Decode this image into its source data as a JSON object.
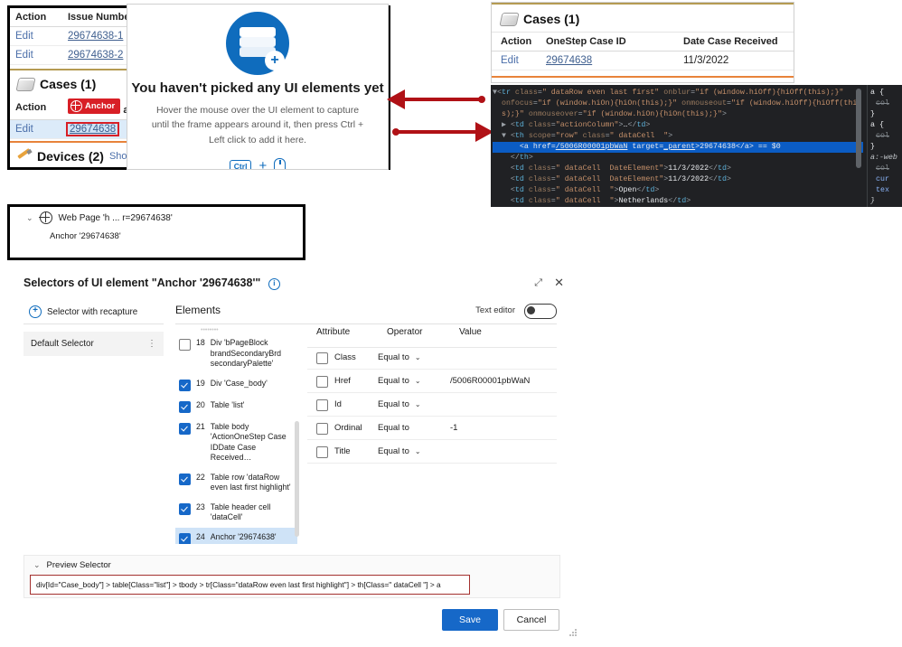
{
  "sf_left": {
    "issues_table": {
      "headers": [
        "Action",
        "Issue Number"
      ],
      "rows": [
        {
          "action": "Edit",
          "issue": "29674638-1"
        },
        {
          "action": "Edit",
          "issue": "29674638-2"
        }
      ]
    },
    "cases_section": {
      "title": "Cases (1)",
      "headers": {
        "action": "Action",
        "anchor_badge": "Anchor",
        "case_id": "ase ID"
      },
      "row": {
        "action": "Edit",
        "case_id": "29674638"
      }
    },
    "devices_section": {
      "title": "Devices (2)",
      "link": "Show"
    }
  },
  "picker": {
    "title": "You haven't picked any UI elements yet",
    "subtitle": "Hover the mouse over the UI element to capture until the frame appears around it, then press Ctrl + Left click to add it here.",
    "key_ctrl": "Ctrl",
    "key_plus": "+"
  },
  "sf_right": {
    "title": "Cases (1)",
    "headers": [
      "Action",
      "OneStep Case ID",
      "Date Case Received"
    ],
    "row": {
      "action": "Edit",
      "case_id": "29674638",
      "date_received": "11/3/2022"
    }
  },
  "devtools": {
    "dom_lines": [
      "▼<tr class=\" dataRow even last first\" onblur=\"if (window.hiOff){hiOff(this);}\"",
      "  onfocus=\"if (window.hiOn){hiOn(this);}\" onmouseout=\"if (window.hiOff){hiOff(thi",
      "  s);}\" onmouseover=\"if (window.hiOn){hiOn(this);}\">",
      "  ▶ <td class=\"actionColumn\">…</td>",
      "  ▼ <th scope=\"row\" class=\" dataCell  \">",
      "      <a href=\"/5006R00001pbWaN\" target=\"_parent\">29674638</a> == $0",
      "    </th>",
      "    <td class=\" dataCell  DateElement\">11/3/2022</td>",
      "    <td class=\" dataCell  DateElement\">11/3/2022</td>",
      "    <td class=\" dataCell  \">Open</td>",
      "    <td class=\" dataCell  \">Netherlands</td>"
    ],
    "selected_line": {
      "href": "/5006R00001pbWaN",
      "target": "_parent",
      "text": "29674638",
      "marker": "== $0"
    },
    "css_pane": [
      "a {",
      "col",
      "}",
      "a {",
      "col",
      "}",
      "a:-web",
      "col",
      "cur",
      "tex",
      "}"
    ]
  },
  "tree": {
    "root": "Web Page 'h ... r=29674638'",
    "child": "Anchor '29674638'"
  },
  "dialog": {
    "title": "Selectors of UI element \"Anchor '29674638'\"",
    "info_icon": "i",
    "expand_icon": "⤢",
    "close_icon": "✕",
    "left_pane": {
      "recapture_label": "Selector with recapture",
      "default_selector": "Default Selector"
    },
    "elements_label": "Elements",
    "text_editor_label": "Text editor",
    "text_editor_on": false,
    "elements": [
      {
        "num": "18",
        "label": "Div 'bPageBlock brandSecondaryBrd secondaryPalette'",
        "checked": false,
        "selected": false
      },
      {
        "num": "19",
        "label": "Div 'Case_body'",
        "checked": true,
        "selected": false
      },
      {
        "num": "20",
        "label": "Table 'list'",
        "checked": true,
        "selected": false
      },
      {
        "num": "21",
        "label": "Table body 'ActionOneStep Case IDDate Case Received…",
        "checked": true,
        "selected": false
      },
      {
        "num": "22",
        "label": "Table row 'dataRow even last first highlight'",
        "checked": true,
        "selected": false
      },
      {
        "num": "23",
        "label": "Table header cell 'dataCell'",
        "checked": true,
        "selected": false
      },
      {
        "num": "24",
        "label": "Anchor '29674638'",
        "checked": true,
        "selected": true
      }
    ],
    "attr_headers": [
      "Attribute",
      "Operator",
      "Value"
    ],
    "attributes": [
      {
        "name": "Class",
        "operator": "Equal to",
        "value": "",
        "checked": false,
        "has_chevron": true
      },
      {
        "name": "Href",
        "operator": "Equal to",
        "value": "/5006R00001pbWaN",
        "checked": false,
        "has_chevron": true
      },
      {
        "name": "Id",
        "operator": "Equal to",
        "value": "",
        "checked": false,
        "has_chevron": true
      },
      {
        "name": "Ordinal",
        "operator": "Equal to",
        "value": "-1",
        "checked": false,
        "has_chevron": false
      },
      {
        "name": "Title",
        "operator": "Equal to",
        "value": "",
        "checked": false,
        "has_chevron": true
      }
    ],
    "preview": {
      "label": "Preview Selector",
      "value": "div[Id=\"Case_body\"] > table[Class=\"list\"] > tbody > tr[Class=\"dataRow even last first highlight\"] > th[Class=\" dataCell  \"] > a"
    },
    "save_label": "Save",
    "cancel_label": "Cancel"
  },
  "colors": {
    "accent_blue": "#1668c8",
    "arrow_red": "#b01116",
    "badge_red": "#d81f26",
    "devtools_bg": "#202124",
    "selection_blue": "#0b5cc4"
  }
}
